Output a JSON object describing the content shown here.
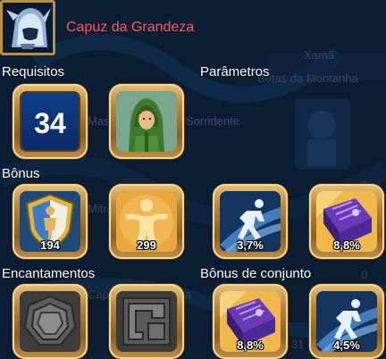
{
  "item": {
    "name": "Capuz da Grandeza",
    "icon": "hood-helmet-icon"
  },
  "sections": {
    "requirements": "Requisitos",
    "parameters": "Parâmetros",
    "bonus": "Bônus",
    "enchantments": "Encantamentos",
    "set_bonus": "Bônus de conjunto"
  },
  "requirements": {
    "level": "34",
    "class_icon": "green-hood-character-icon"
  },
  "bonus_slots": [
    {
      "icon": "shield-defense-icon",
      "value": "194"
    },
    {
      "icon": "golden-figure-icon",
      "value": "299"
    },
    {
      "icon": "swift-figure-icon",
      "value": "3,7%"
    },
    {
      "icon": "purple-book-icon",
      "value": "8,8%"
    }
  ],
  "enchant_slots": [
    {
      "icon": "empty-rune-circle-icon"
    },
    {
      "icon": "empty-rune-square-icon"
    }
  ],
  "set_bonus_slots": [
    {
      "icon": "purple-book-icon",
      "value": "8,8%"
    },
    {
      "icon": "swift-figure-icon",
      "value": "4,5%"
    }
  ],
  "background_text": {
    "class_name": "Xamã",
    "item_line": "Botas da Montanha",
    "req_ghost_1": "Mas",
    "req_ghost_2": "Sorridente",
    "bonus_ghost": "Mitre da Grandeza",
    "enchant_ghost": "Capuz da Grandeza",
    "zero_1": "0",
    "zero_2": "0",
    "zero_3": "0",
    "partial_num": "31"
  },
  "colors": {
    "background": "#0b1d33",
    "title": "#ff5a5a",
    "frame_gold": "#b89042"
  }
}
